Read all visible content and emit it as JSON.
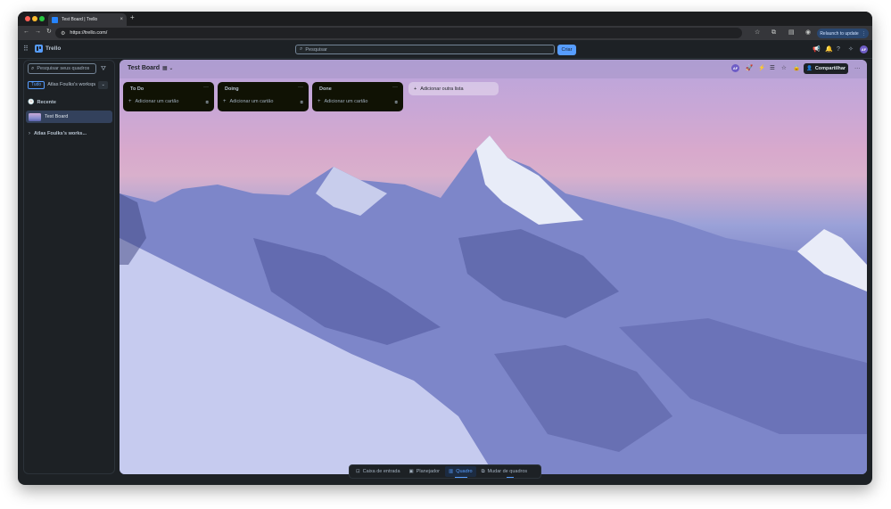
{
  "browser": {
    "tab_title": "Test Board | Trello",
    "tab_close": "×",
    "new_tab": "+",
    "url": "https://trello.com/",
    "relaunch_label": "Relaunch to update",
    "relaunch_more": "⋮"
  },
  "header": {
    "logo_text": "Trello",
    "search_placeholder": "Pesquisar",
    "create_label": "Criar",
    "avatar_initials": "AF"
  },
  "sidebar": {
    "search_placeholder": "Pesquisar seus quadros",
    "filter_all": "Tudo",
    "workspace_name": "Atlas Foulks's workspace",
    "recent_label": "Recente",
    "board_name": "Test Board",
    "workspace_tree_label": "Atlas Foulks's works..."
  },
  "board": {
    "title": "Test Board",
    "avatar_initials": "AF",
    "share_label": "Compartilhar",
    "more": "···",
    "add_list_label": "Adicionar outra lista",
    "lists": [
      {
        "title": "To Do",
        "more": "···",
        "add_card_label": "Adicionar um cartão"
      },
      {
        "title": "Doing",
        "more": "···",
        "add_card_label": "Adicionar um cartão"
      },
      {
        "title": "Done",
        "more": "···",
        "add_card_label": "Adicionar um cartão"
      }
    ]
  },
  "bottom_bar": {
    "items": [
      {
        "label": "Caixa de entrada",
        "icon": "inbox-icon"
      },
      {
        "label": "Planejador",
        "icon": "calendar-icon"
      },
      {
        "label": "Quadro",
        "icon": "board-icon",
        "active": true
      },
      {
        "label": "Mudar de quadros",
        "icon": "switch-boards-icon"
      }
    ]
  }
}
